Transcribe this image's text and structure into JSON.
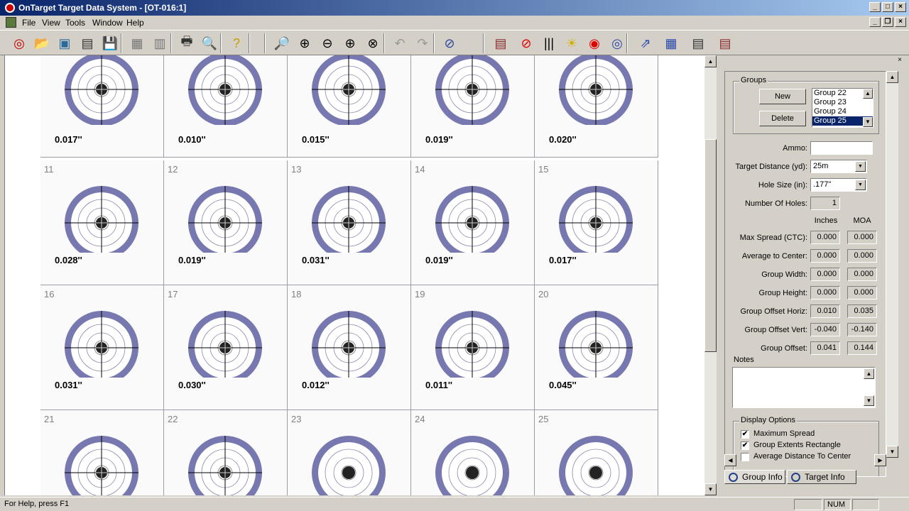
{
  "window": {
    "title": "OnTarget Target Data System - [OT-016:1]",
    "buttons": [
      "_",
      "□",
      "×"
    ],
    "mdi_buttons": [
      "_",
      "❐",
      "×"
    ]
  },
  "menu": {
    "items": [
      "File",
      "View",
      "Tools",
      "Window",
      "Help"
    ]
  },
  "toolbar": {
    "buttons": [
      {
        "name": "new-target-icon",
        "glyph": "◎",
        "color": "#c00000"
      },
      {
        "name": "open-folder-icon",
        "glyph": "📂",
        "color": "#c8a000"
      },
      {
        "name": "open-image-icon",
        "glyph": "▣",
        "color": "#2a6a9a"
      },
      {
        "name": "scan-icon",
        "glyph": "▤",
        "color": "#333333"
      },
      {
        "name": "save-icon",
        "glyph": "💾",
        "color": "#000000"
      },
      {
        "name": "add-image-icon",
        "glyph": "▦",
        "color": "#777777"
      },
      {
        "name": "batch-icon",
        "glyph": "▥",
        "color": "#777777"
      },
      {
        "name": "print-icon",
        "glyph": "🖶",
        "color": "#333333"
      },
      {
        "name": "print-preview-icon",
        "glyph": "🔍",
        "color": "#333333"
      },
      {
        "name": "help-icon",
        "glyph": "?",
        "color": "#c8a000"
      },
      {
        "name": "zoom-icon",
        "glyph": "🔎",
        "color": "#000000"
      },
      {
        "name": "zoom-in-icon",
        "glyph": "⊕",
        "color": "#000000"
      },
      {
        "name": "zoom-out-icon",
        "glyph": "⊖",
        "color": "#000000"
      },
      {
        "name": "zoom-fit-icon",
        "glyph": "⊕",
        "color": "#000000"
      },
      {
        "name": "zoom-reset-icon",
        "glyph": "⊗",
        "color": "#000000"
      },
      {
        "name": "undo-icon",
        "glyph": "↶",
        "color": "#999999"
      },
      {
        "name": "redo-icon",
        "glyph": "↷",
        "color": "#999999"
      },
      {
        "name": "calibrate-icon",
        "glyph": "⊘",
        "color": "#2a4a9a"
      },
      {
        "name": "report-icon",
        "glyph": "▤",
        "color": "#8a2a2a"
      },
      {
        "name": "cancel-icon",
        "glyph": "⊘",
        "color": "#e00000"
      },
      {
        "name": "barcode-icon",
        "glyph": "|||",
        "color": "#000000"
      },
      {
        "name": "brightness-icon",
        "glyph": "☀",
        "color": "#d0b000"
      },
      {
        "name": "red-target-icon",
        "glyph": "◉",
        "color": "#e00000"
      },
      {
        "name": "blue-target-icon",
        "glyph": "◎",
        "color": "#2a4aaa"
      },
      {
        "name": "export-icon",
        "glyph": "⇗",
        "color": "#2a4aaa"
      },
      {
        "name": "window-layout-icon",
        "glyph": "▦",
        "color": "#2a4aaa"
      },
      {
        "name": "stack-icon",
        "glyph": "▤",
        "color": "#333333"
      },
      {
        "name": "stack-print-icon",
        "glyph": "▤",
        "color": "#8a2a2a"
      }
    ]
  },
  "targets": [
    {
      "num": "",
      "value": "0.017''",
      "tight": true
    },
    {
      "num": "",
      "value": "0.010''",
      "tight": true
    },
    {
      "num": "",
      "value": "0.015''",
      "tight": true
    },
    {
      "num": "",
      "value": "0.019''",
      "tight": true
    },
    {
      "num": "",
      "value": "0.020''",
      "tight": true
    },
    {
      "num": "11",
      "value": "0.028''",
      "tight": true
    },
    {
      "num": "12",
      "value": "0.019''",
      "tight": true
    },
    {
      "num": "13",
      "value": "0.031''",
      "tight": true
    },
    {
      "num": "14",
      "value": "0.019''",
      "tight": true
    },
    {
      "num": "15",
      "value": "0.017''",
      "tight": true
    },
    {
      "num": "16",
      "value": "0.031''",
      "tight": true
    },
    {
      "num": "17",
      "value": "0.030''",
      "tight": true
    },
    {
      "num": "18",
      "value": "0.012''",
      "tight": true
    },
    {
      "num": "19",
      "value": "0.011''",
      "tight": true
    },
    {
      "num": "20",
      "value": "0.045''",
      "tight": true
    },
    {
      "num": "21",
      "value": "",
      "tight": true
    },
    {
      "num": "22",
      "value": "",
      "tight": true
    },
    {
      "num": "23",
      "value": "",
      "tight": false
    },
    {
      "num": "24",
      "value": "",
      "tight": false
    },
    {
      "num": "25",
      "value": "",
      "tight": false
    }
  ],
  "panel": {
    "groups_legend": "Groups",
    "new_label": "New",
    "delete_label": "Delete",
    "group_list": [
      "Group 22",
      "Group 23",
      "Group 24",
      "Group 25"
    ],
    "selected_group": "Group 25",
    "ammo_label": "Ammo:",
    "ammo_value": "",
    "distance_label": "Target Distance (yd):",
    "distance_value": "25m",
    "hole_label": "Hole Size (in):",
    "hole_value": ".177\"",
    "holes_label": "Number Of Holes:",
    "holes_value": "1",
    "col_inches": "Inches",
    "col_moa": "MOA",
    "stats": [
      {
        "label": "Max Spread (CTC):",
        "inches": "0.000",
        "moa": "0.000"
      },
      {
        "label": "Average to Center:",
        "inches": "0.000",
        "moa": "0.000"
      },
      {
        "label": "Group Width:",
        "inches": "0.000",
        "moa": "0.000"
      },
      {
        "label": "Group Height:",
        "inches": "0.000",
        "moa": "0.000"
      },
      {
        "label": "Group Offset Horiz:",
        "inches": "0.010",
        "moa": "0.035"
      },
      {
        "label": "Group Offset Vert:",
        "inches": "-0.040",
        "moa": "-0.140"
      },
      {
        "label": "Group Offset:",
        "inches": "0.041",
        "moa": "0.144"
      }
    ],
    "notes_label": "Notes",
    "notes_value": "",
    "display_legend": "Display Options",
    "display_options": [
      {
        "label": "Maximum Spread",
        "checked": true
      },
      {
        "label": "Group Extents Rectangle",
        "checked": true
      },
      {
        "label": "Average Distance To Center",
        "checked": false
      }
    ],
    "tabs": [
      "Group Info",
      "Target Info"
    ]
  },
  "status": {
    "help_text": "For Help, press F1",
    "num_indicator": "NUM"
  },
  "colors": {
    "target_ring": "#7878b0",
    "title_start": "#0a246a",
    "title_end": "#a6caf0"
  }
}
